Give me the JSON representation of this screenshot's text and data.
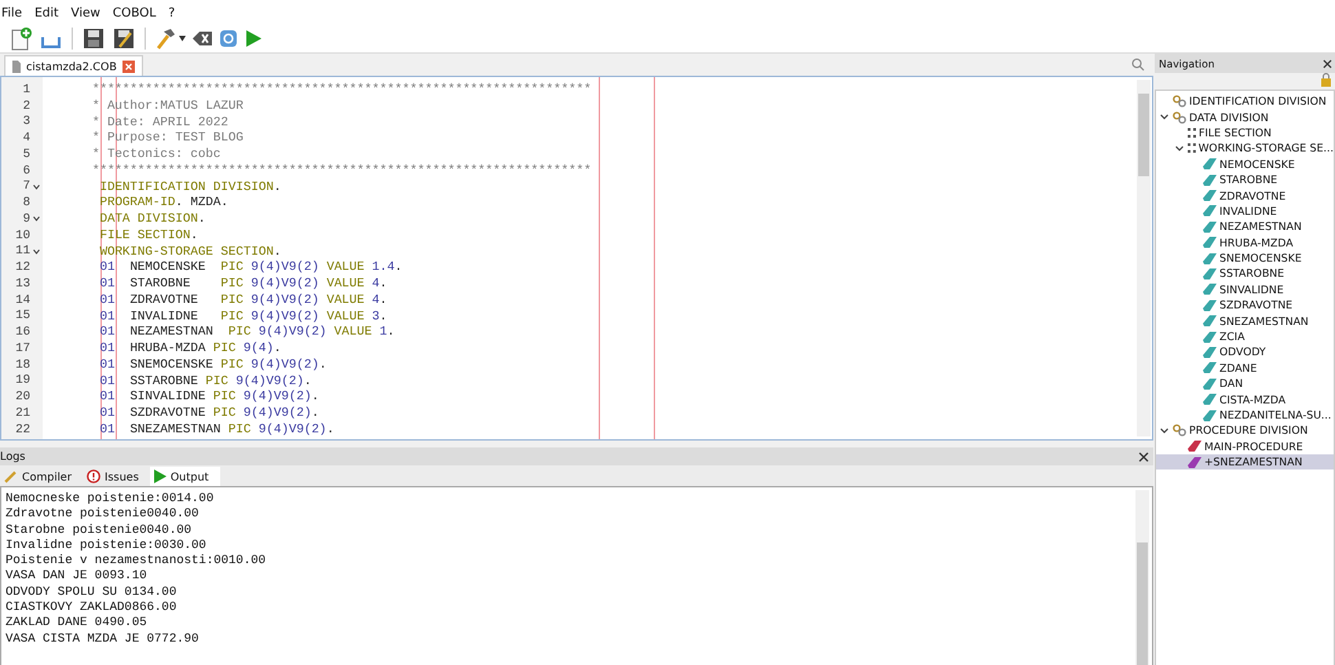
{
  "menu": [
    "File",
    "Edit",
    "View",
    "COBOL",
    "?"
  ],
  "editor": {
    "tabs": [
      {
        "label": "cistamzda2.COB",
        "selected": true
      }
    ],
    "lines": [
      {
        "number": "1",
        "kind": "comment",
        "foldable": false,
        "tokens": [
          {
            "kind": "comment",
            "text": "******************************************************************"
          }
        ]
      },
      {
        "number": "2",
        "kind": "comment",
        "foldable": false,
        "tokens": [
          {
            "kind": "comment",
            "text": "* Author:MATUS LAZUR"
          }
        ]
      },
      {
        "number": "3",
        "kind": "comment",
        "foldable": false,
        "tokens": [
          {
            "kind": "comment",
            "text": "* Date: APRIL 2022"
          }
        ]
      },
      {
        "number": "4",
        "kind": "comment",
        "foldable": false,
        "tokens": [
          {
            "kind": "comment",
            "text": "* Purpose: TEST BLOG"
          }
        ]
      },
      {
        "number": "5",
        "kind": "comment",
        "foldable": false,
        "tokens": [
          {
            "kind": "comment",
            "text": "* Tectonics: cobc"
          }
        ]
      },
      {
        "number": "6",
        "kind": "comment",
        "foldable": false,
        "tokens": [
          {
            "kind": "comment",
            "text": "******************************************************************"
          }
        ]
      },
      {
        "number": "7",
        "kind": "code",
        "foldable": true,
        "tokens": [
          {
            "kind": "keyword",
            "text": "IDENTIFICATION DIVISION"
          },
          {
            "kind": "plain",
            "text": "."
          }
        ]
      },
      {
        "number": "8",
        "kind": "code",
        "foldable": false,
        "tokens": [
          {
            "kind": "keyword",
            "text": "PROGRAM-ID"
          },
          {
            "kind": "plain",
            "text": ". MZDA."
          }
        ]
      },
      {
        "number": "9",
        "kind": "code",
        "foldable": true,
        "tokens": [
          {
            "kind": "keyword",
            "text": "DATA DIVISION"
          },
          {
            "kind": "plain",
            "text": "."
          }
        ]
      },
      {
        "number": "10",
        "kind": "code",
        "foldable": false,
        "tokens": [
          {
            "kind": "keyword",
            "text": "FILE SECTION"
          },
          {
            "kind": "plain",
            "text": "."
          }
        ]
      },
      {
        "number": "11",
        "kind": "code",
        "foldable": true,
        "tokens": [
          {
            "kind": "keyword",
            "text": "WORKING-STORAGE SECTION"
          },
          {
            "kind": "plain",
            "text": "."
          }
        ]
      },
      {
        "number": "12",
        "kind": "code",
        "foldable": false,
        "tokens": [
          {
            "kind": "number",
            "text": "01"
          },
          {
            "kind": "plain",
            "text": "  NEMOCENSKE  "
          },
          {
            "kind": "keyword",
            "text": "PIC"
          },
          {
            "kind": "number",
            "text": " 9(4)V9(2)"
          },
          {
            "kind": "keyword",
            "text": " VALUE"
          },
          {
            "kind": "number",
            "text": " 1.4"
          },
          {
            "kind": "plain",
            "text": "."
          }
        ]
      },
      {
        "number": "13",
        "kind": "code",
        "foldable": false,
        "tokens": [
          {
            "kind": "number",
            "text": "01"
          },
          {
            "kind": "plain",
            "text": "  STAROBNE    "
          },
          {
            "kind": "keyword",
            "text": "PIC"
          },
          {
            "kind": "number",
            "text": " 9(4)V9(2)"
          },
          {
            "kind": "keyword",
            "text": " VALUE"
          },
          {
            "kind": "number",
            "text": " 4"
          },
          {
            "kind": "plain",
            "text": "."
          }
        ]
      },
      {
        "number": "14",
        "kind": "code",
        "foldable": false,
        "tokens": [
          {
            "kind": "number",
            "text": "01"
          },
          {
            "kind": "plain",
            "text": "  ZDRAVOTNE   "
          },
          {
            "kind": "keyword",
            "text": "PIC"
          },
          {
            "kind": "number",
            "text": " 9(4)V9(2)"
          },
          {
            "kind": "keyword",
            "text": " VALUE"
          },
          {
            "kind": "number",
            "text": " 4"
          },
          {
            "kind": "plain",
            "text": "."
          }
        ]
      },
      {
        "number": "15",
        "kind": "code",
        "foldable": false,
        "tokens": [
          {
            "kind": "number",
            "text": "01"
          },
          {
            "kind": "plain",
            "text": "  INVALIDNE   "
          },
          {
            "kind": "keyword",
            "text": "PIC"
          },
          {
            "kind": "number",
            "text": " 9(4)V9(2)"
          },
          {
            "kind": "keyword",
            "text": " VALUE"
          },
          {
            "kind": "number",
            "text": " 3"
          },
          {
            "kind": "plain",
            "text": "."
          }
        ]
      },
      {
        "number": "16",
        "kind": "code",
        "foldable": false,
        "tokens": [
          {
            "kind": "number",
            "text": "01"
          },
          {
            "kind": "plain",
            "text": "  NEZAMESTNAN  "
          },
          {
            "kind": "keyword",
            "text": "PIC"
          },
          {
            "kind": "number",
            "text": " 9(4)V9(2)"
          },
          {
            "kind": "keyword",
            "text": " VALUE"
          },
          {
            "kind": "number",
            "text": " 1"
          },
          {
            "kind": "plain",
            "text": "."
          }
        ]
      },
      {
        "number": "17",
        "kind": "code",
        "foldable": false,
        "tokens": [
          {
            "kind": "number",
            "text": "01"
          },
          {
            "kind": "plain",
            "text": "  HRUBA-MZDA "
          },
          {
            "kind": "keyword",
            "text": "PIC"
          },
          {
            "kind": "number",
            "text": " 9(4)"
          },
          {
            "kind": "plain",
            "text": "."
          }
        ]
      },
      {
        "number": "18",
        "kind": "code",
        "foldable": false,
        "tokens": [
          {
            "kind": "number",
            "text": "01"
          },
          {
            "kind": "plain",
            "text": "  SNEMOCENSKE "
          },
          {
            "kind": "keyword",
            "text": "PIC"
          },
          {
            "kind": "number",
            "text": " 9(4)V9(2)"
          },
          {
            "kind": "plain",
            "text": "."
          }
        ]
      },
      {
        "number": "19",
        "kind": "code",
        "foldable": false,
        "tokens": [
          {
            "kind": "number",
            "text": "01"
          },
          {
            "kind": "plain",
            "text": "  SSTAROBNE "
          },
          {
            "kind": "keyword",
            "text": "PIC"
          },
          {
            "kind": "number",
            "text": " 9(4)V9(2)"
          },
          {
            "kind": "plain",
            "text": "."
          }
        ]
      },
      {
        "number": "20",
        "kind": "code",
        "foldable": false,
        "tokens": [
          {
            "kind": "number",
            "text": "01"
          },
          {
            "kind": "plain",
            "text": "  SINVALIDNE "
          },
          {
            "kind": "keyword",
            "text": "PIC"
          },
          {
            "kind": "number",
            "text": " 9(4)V9(2)"
          },
          {
            "kind": "plain",
            "text": "."
          }
        ]
      },
      {
        "number": "21",
        "kind": "code",
        "foldable": false,
        "tokens": [
          {
            "kind": "number",
            "text": "01"
          },
          {
            "kind": "plain",
            "text": "  SZDRAVOTNE "
          },
          {
            "kind": "keyword",
            "text": "PIC"
          },
          {
            "kind": "number",
            "text": " 9(4)V9(2)"
          },
          {
            "kind": "plain",
            "text": "."
          }
        ]
      },
      {
        "number": "22",
        "kind": "code",
        "foldable": false,
        "tokens": [
          {
            "kind": "number",
            "text": "01"
          },
          {
            "kind": "plain",
            "text": "  SNEZAMESTNAN "
          },
          {
            "kind": "keyword",
            "text": "PIC"
          },
          {
            "kind": "number",
            "text": " 9(4)V9(2)"
          },
          {
            "kind": "plain",
            "text": "."
          }
        ]
      }
    ]
  },
  "logs": {
    "title": "Logs",
    "tabs": [
      {
        "label": "Compiler",
        "kind": "compiler",
        "selected": false
      },
      {
        "label": "Issues",
        "kind": "issues",
        "selected": false
      },
      {
        "label": "Output",
        "kind": "output",
        "selected": true
      }
    ],
    "output": [
      "Nemocneske poistenie:0014.00",
      "Zdravotne poistenie0040.00",
      "Starobne poistenie0040.00",
      "Invalidne poistenie:0030.00",
      "Poistenie v nezamestnanosti:0010.00",
      "VASA DAN JE 0093.10",
      "ODVODY SPOLU SU 0134.00",
      "CIASTKOVY ZAKLAD0866.00",
      "ZAKLAD DANE 0490.05",
      "VASA CISTA MZDA JE 0772.90"
    ]
  },
  "navigation": {
    "title": "Navigation",
    "tree": [
      {
        "label": "IDENTIFICATION DIVISION",
        "kind": "division",
        "selected": false
      },
      {
        "label": "DATA DIVISION",
        "kind": "division",
        "expanded": true,
        "selected": false,
        "children": [
          {
            "label": "FILE SECTION",
            "kind": "section",
            "selected": false
          },
          {
            "label": "WORKING-STORAGE SE...",
            "kind": "section",
            "expanded": true,
            "selected": false,
            "children": [
              {
                "label": "NEMOCENSKE",
                "kind": "field",
                "selected": false
              },
              {
                "label": "STAROBNE",
                "kind": "field",
                "selected": false
              },
              {
                "label": "ZDRAVOTNE",
                "kind": "field",
                "selected": false
              },
              {
                "label": "INVALIDNE",
                "kind": "field",
                "selected": false
              },
              {
                "label": "NEZAMESTNAN",
                "kind": "field",
                "selected": false
              },
              {
                "label": "HRUBA-MZDA",
                "kind": "field",
                "selected": false
              },
              {
                "label": "SNEMOCENSKE",
                "kind": "field",
                "selected": false
              },
              {
                "label": "SSTAROBNE",
                "kind": "field",
                "selected": false
              },
              {
                "label": "SINVALIDNE",
                "kind": "field",
                "selected": false
              },
              {
                "label": "SZDRAVOTNE",
                "kind": "field",
                "selected": false
              },
              {
                "label": "SNEZAMESTNAN",
                "kind": "field",
                "selected": false
              },
              {
                "label": "ZCIA",
                "kind": "field",
                "selected": false
              },
              {
                "label": "ODVODY",
                "kind": "field",
                "selected": false
              },
              {
                "label": "ZDANE",
                "kind": "field",
                "selected": false
              },
              {
                "label": "DAN",
                "kind": "field",
                "selected": false
              },
              {
                "label": "CISTA-MZDA",
                "kind": "field",
                "selected": false
              },
              {
                "label": "NEZDANITELNA-SU...",
                "kind": "field",
                "selected": false
              }
            ]
          }
        ]
      },
      {
        "label": "PROCEDURE DIVISION",
        "kind": "division",
        "expanded": true,
        "selected": false,
        "children": [
          {
            "label": "MAIN-PROCEDURE",
            "kind": "procedure",
            "selected": false
          },
          {
            "label": "+SNEZAMESTNAN",
            "kind": "paragraph",
            "selected": true
          }
        ]
      }
    ]
  }
}
